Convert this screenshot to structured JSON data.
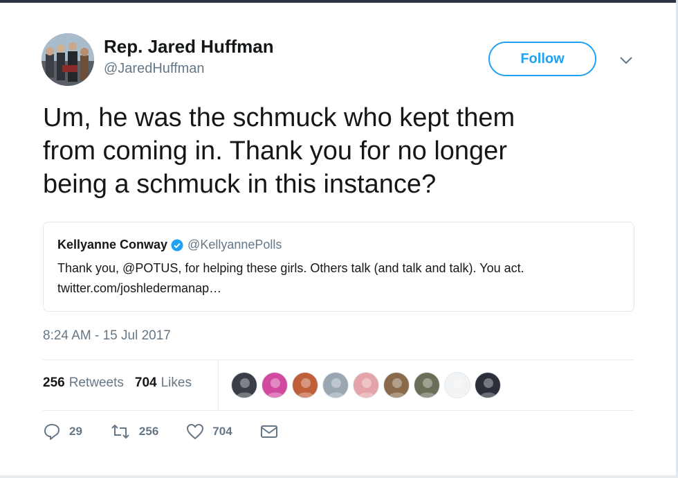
{
  "author": {
    "name": "Rep. Jared Huffman",
    "handle": "@JaredHuffman",
    "avatar_icon": "profile-photo"
  },
  "follow_label": "Follow",
  "tweet_text": "Um, he was the schmuck who kept them\nfrom coming in.  Thank you for no longer\nbeing a schmuck in this instance?",
  "quoted": {
    "name": "Kellyanne Conway",
    "verified": true,
    "handle": "@KellyannePolls",
    "text": "Thank you, @POTUS, for helping these girls. Others talk (and talk and talk). You act. twitter.com/joshledermanap…"
  },
  "timestamp": "8:24 AM - 15 Jul 2017",
  "stats": {
    "retweets_count": "256",
    "retweets_label": "Retweets",
    "likes_count": "704",
    "likes_label": "Likes"
  },
  "likers": [
    {
      "icon": "liker-avatar-1",
      "color": "#3a3f47"
    },
    {
      "icon": "liker-avatar-2",
      "color": "#d24aa0"
    },
    {
      "icon": "liker-avatar-3",
      "color": "#c0603a"
    },
    {
      "icon": "liker-avatar-4",
      "color": "#9aa6b2"
    },
    {
      "icon": "liker-avatar-5",
      "color": "#e4a3a8"
    },
    {
      "icon": "liker-avatar-6",
      "color": "#8a6a4a"
    },
    {
      "icon": "liker-avatar-7",
      "color": "#6b6f58"
    },
    {
      "icon": "liker-avatar-8",
      "color": "#f1f3f5"
    },
    {
      "icon": "liker-avatar-9",
      "color": "#2c2f3a"
    }
  ],
  "actions": {
    "reply_count": "29",
    "retweet_count": "256",
    "like_count": "704"
  },
  "colors": {
    "accent": "#1da1f2",
    "verified": "#1da1f2",
    "secondary_text": "#657786"
  }
}
